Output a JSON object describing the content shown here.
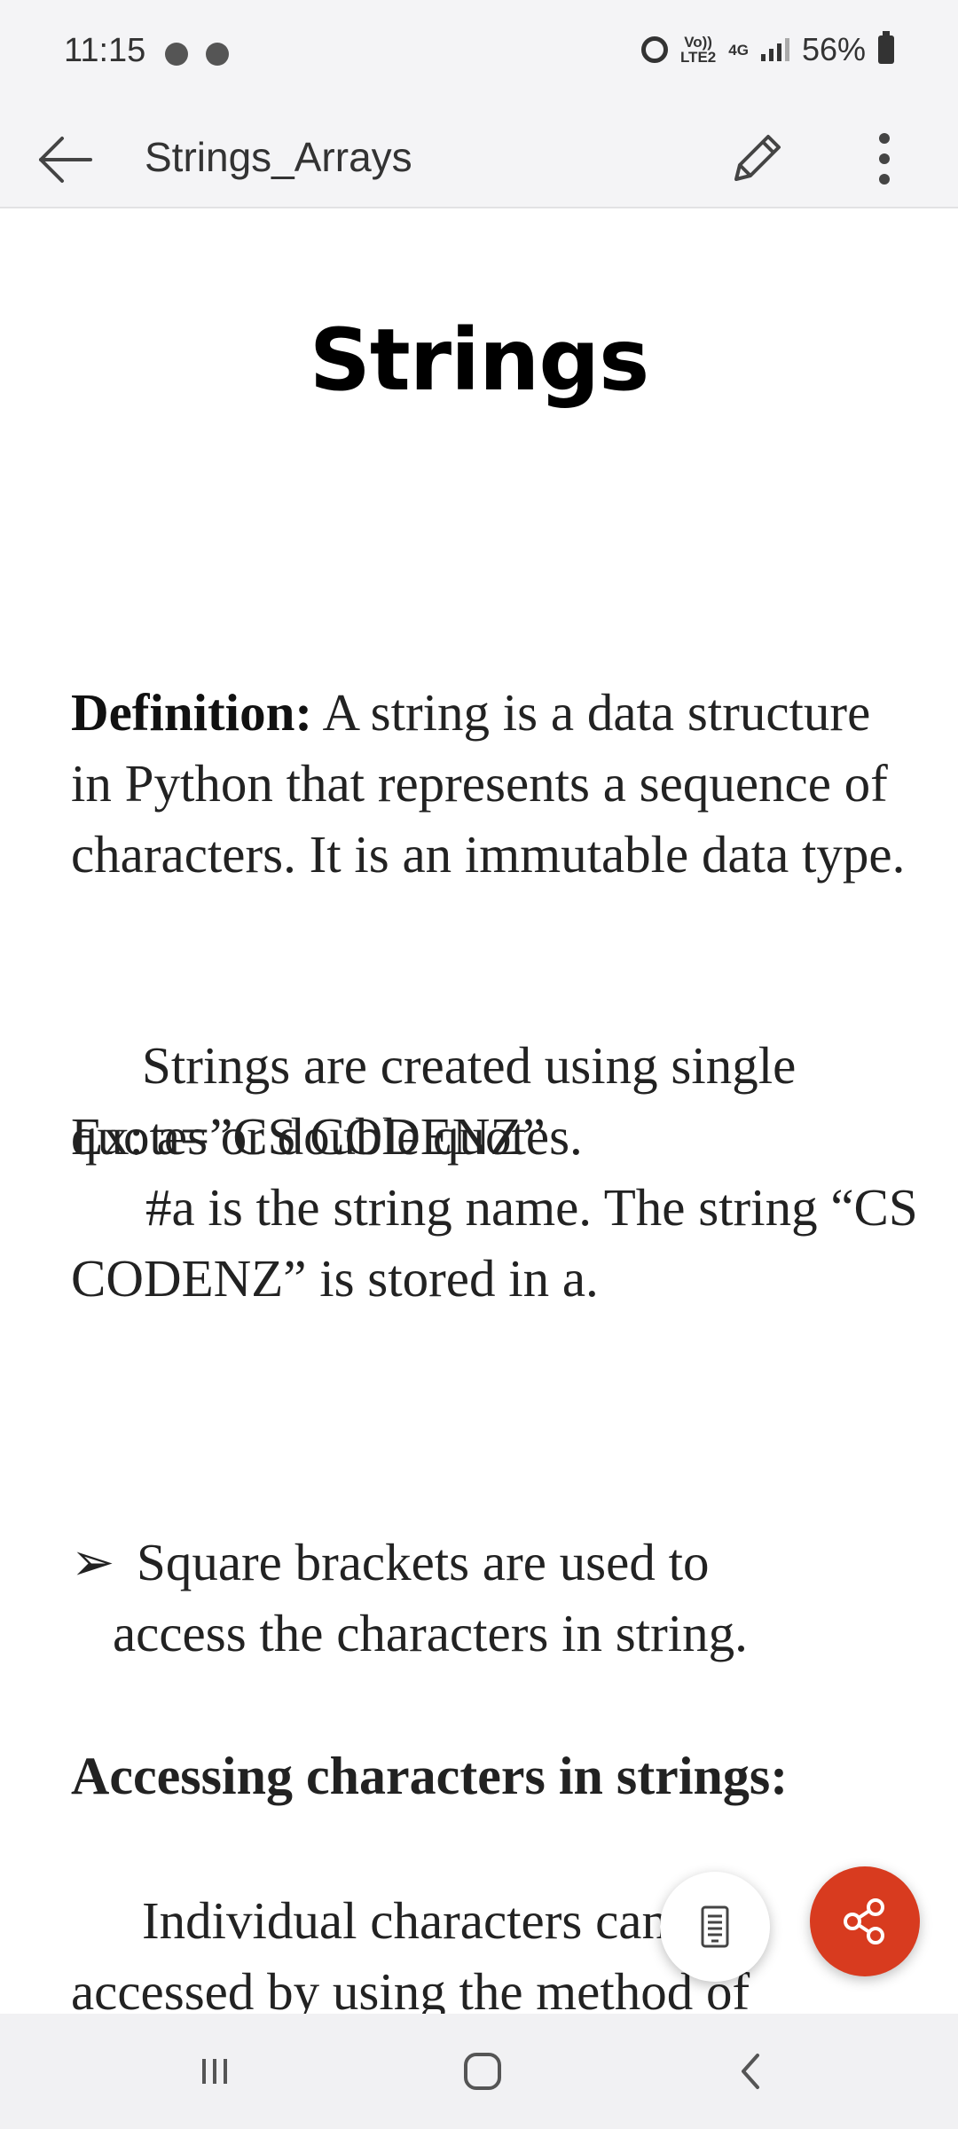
{
  "status_bar": {
    "time": "11:15",
    "volte": "Vo))\nLTE2",
    "network": "4G",
    "battery": "56%"
  },
  "app_bar": {
    "title": "Strings_Arrays"
  },
  "document": {
    "heading": "Strings",
    "definition_label": "Definition:",
    "definition_text": " A string is a data structure in Python that represents a sequence of characters. It is an immutable data type.",
    "created_text": "Strings are created using single quotes or double quotes.",
    "example_text": "Ex: a=”CS CODENZ”",
    "hash_text": "#a is the string name. The string “CS CODENZ” is stored in a.",
    "bullet_arrow": "➢",
    "bullet_line1": "Square brackets are used to",
    "bullet_line2": "access the characters in string.",
    "section_heading": "Accessing characters in strings:",
    "individual_text": "Individual characters can be accessed by using the method of"
  },
  "colors": {
    "accent": "#d83b1f",
    "bar_background": "#f4f4f6"
  },
  "icons": {
    "back": "arrow-left-icon",
    "edit": "pencil-icon",
    "more": "more-vertical-icon",
    "reader": "reading-mode-icon",
    "share": "share-icon",
    "nav_recents": "recents-icon",
    "nav_home": "home-icon",
    "nav_back": "nav-back-icon"
  }
}
